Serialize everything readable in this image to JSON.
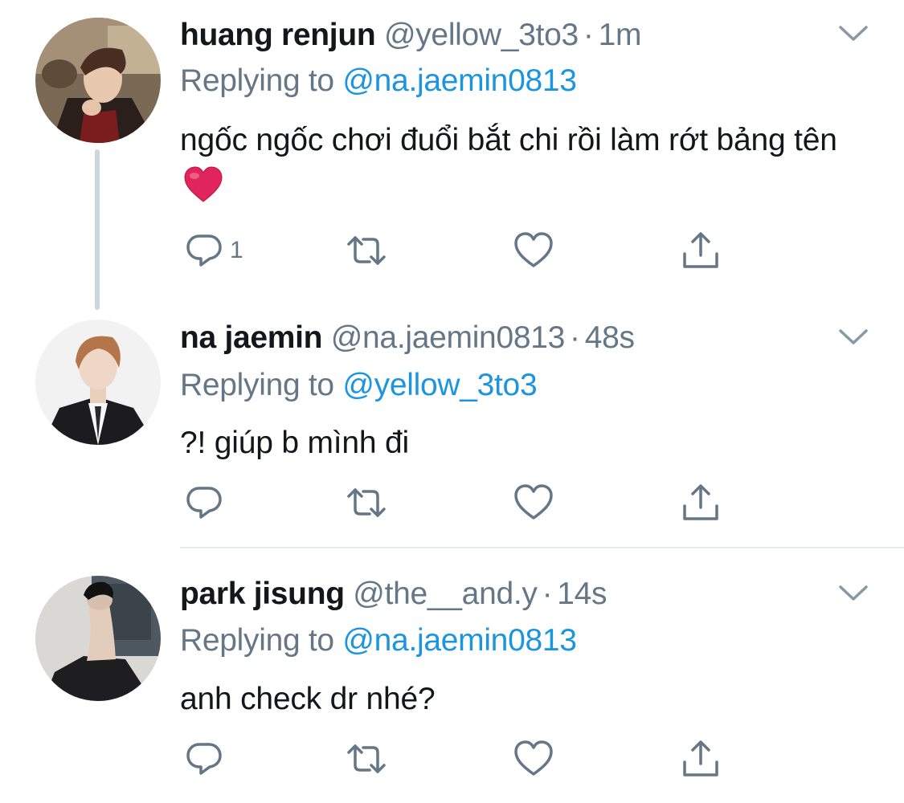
{
  "tweets": [
    {
      "name": "huang renjun",
      "handle": "@yellow_3to3",
      "dot": "·",
      "time": "1m",
      "reply_prefix": "Replying to",
      "reply_to": "@na.jaemin0813",
      "text": "ngốc ngốc chơi đuổi bắt chi rồi làm rớt bảng tên",
      "emoji": "red-heart",
      "reply_count": "1"
    },
    {
      "name": "na jaemin",
      "handle": "@na.jaemin0813",
      "dot": "·",
      "time": "48s",
      "reply_prefix": "Replying to",
      "reply_to": "@yellow_3to3",
      "text": "?! giúp b mình đi",
      "reply_count": ""
    },
    {
      "name": "park jisung",
      "handle": "@the__and.y",
      "dot": "·",
      "time": "14s",
      "reply_prefix": "Replying to",
      "reply_to": "@na.jaemin0813",
      "text": "anh check dr nhé?",
      "reply_count": ""
    }
  ],
  "colors": {
    "text": "#14171a",
    "secondary": "#657786",
    "link": "#1b95e0",
    "thread_line": "#ccd6dd",
    "heart": "#e0245e"
  },
  "icons": [
    "reply-icon",
    "retweet-icon",
    "like-icon",
    "share-icon",
    "chevron-down-icon"
  ]
}
